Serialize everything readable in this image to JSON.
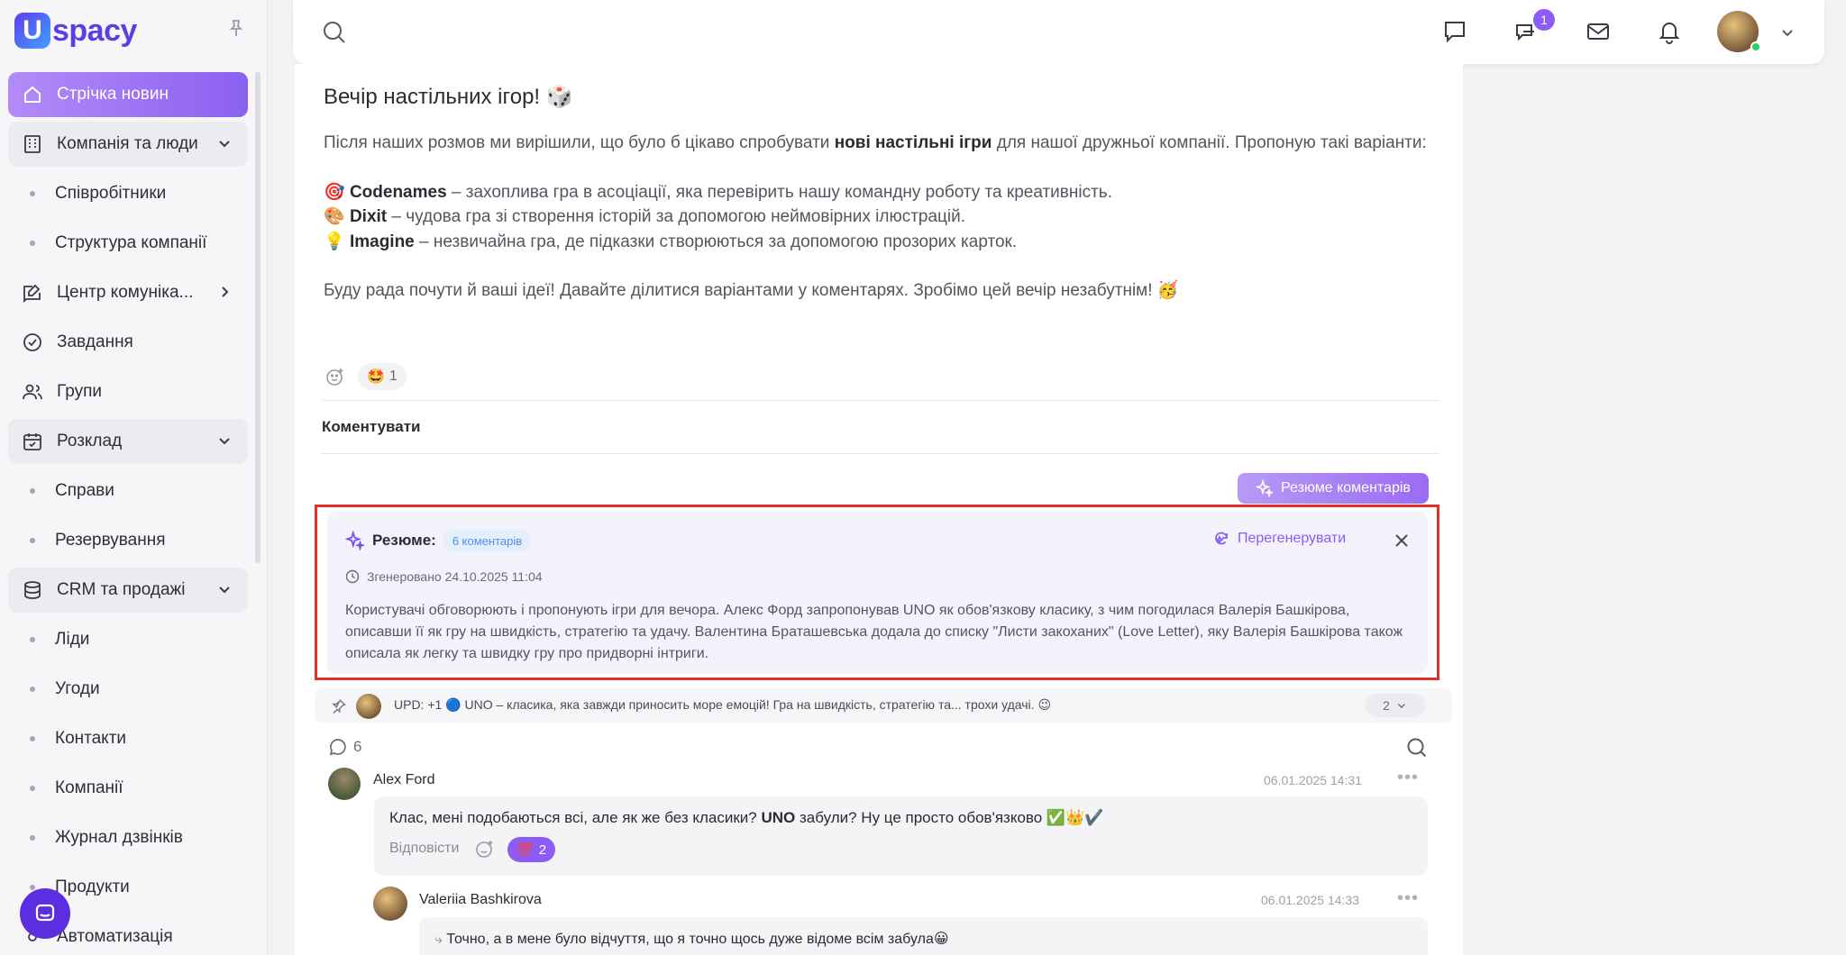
{
  "brand": {
    "logo_mark": "U",
    "logo_text": "spacy"
  },
  "sidebar": {
    "items": [
      {
        "label": "Стрічка новин",
        "type": "active"
      },
      {
        "label": "Компанія та люди",
        "type": "group"
      },
      {
        "label": "Співробітники",
        "type": "sub"
      },
      {
        "label": "Структура компанії",
        "type": "sub"
      },
      {
        "label": "Центр комуніка...",
        "type": "item"
      },
      {
        "label": "Завдання",
        "type": "item"
      },
      {
        "label": "Групи",
        "type": "item"
      },
      {
        "label": "Розклад",
        "type": "group"
      },
      {
        "label": "Справи",
        "type": "sub"
      },
      {
        "label": "Резервування",
        "type": "sub"
      },
      {
        "label": "CRM та продажі",
        "type": "group"
      },
      {
        "label": "Ліди",
        "type": "sub"
      },
      {
        "label": "Угоди",
        "type": "sub"
      },
      {
        "label": "Контакти",
        "type": "sub"
      },
      {
        "label": "Компанії",
        "type": "sub"
      },
      {
        "label": "Журнал дзвінків",
        "type": "sub"
      },
      {
        "label": "Продукти",
        "type": "sub"
      },
      {
        "label": "Автоматизація",
        "type": "item"
      }
    ]
  },
  "topbar": {
    "messages_badge": "1"
  },
  "post": {
    "title": "Вечір настільних ігор! 🎲",
    "intro_1": "Після наших розмов ми вирішили, що було б цікаво спробувати ",
    "intro_bold": "нові настільні ігри",
    "intro_2": " для нашої дружньої компанії. Пропоную такі варіанти:",
    "games": [
      {
        "emoji": "🎯",
        "name": "Codenames",
        "desc": " – захоплива гра в асоціації, яка перевірить нашу командну роботу та креативність."
      },
      {
        "emoji": "🎨",
        "name": "Dixit",
        "desc": " – чудова гра зі створення історій за допомогою неймовірних ілюстрацій."
      },
      {
        "emoji": "💡",
        "name": "Imagine",
        "desc": " – незвичайна гра, де підказки створюються за допомогою прозорих карток."
      }
    ],
    "outro": "Буду рада почути й ваші ідеї! Давайте ділитися варіантами у коментарях. Зробімо цей вечір незабутнім! 🥳",
    "reaction_emoji": "🤩",
    "reaction_count": "1"
  },
  "comments": {
    "tab_label": "Коментувати",
    "summary_button": "Резюме коментарів",
    "summary": {
      "label": "Резюме:",
      "count_badge": "6 коментарів",
      "regenerate": "Перегенерувати",
      "generated": "Згенеровано 24.10.2025 11:04",
      "text": "Користувачі обговорюють і пропонують ігри для вечора. Алекс Форд запропонував UNO як обов'язкову класику, з чим погодилася Валерія Башкірова, описавши її як гру на швидкість, стратегію та удачу. Валентина Браташевська додала до списку \"Листи закоханих\" (Love Letter), яку Валерія Башкірова також описала як легку та швидку гру про придворні інтриги."
    },
    "pinned": {
      "text": "UPD: +1 🔵 UNO – класика, яка завжди приносить море емоцій! Гра на швидкість, стратегію та... трохи удачі. 😉",
      "count": "2"
    },
    "total": "6",
    "list": [
      {
        "author": "Alex Ford",
        "date": "06.01.2025 14:31",
        "text_1": "Клас, мені подобаються всі, але як же без класики? ",
        "text_bold": "UNO",
        "text_2": " забули? Ну це просто обов'язково ✅👑✔️",
        "reply_label": "Відповісти",
        "reaction_emoji": "💯",
        "reaction_count": "2"
      },
      {
        "author": "Valeriia Bashkirova",
        "date": "06.01.2025 14:33",
        "text": "Точно, а в мене було відчуття, що я точно щось дуже відоме всім забула😀"
      }
    ]
  },
  "colors": {
    "accent": "#8b5cf6",
    "highlight_outline": "#e0302a"
  }
}
